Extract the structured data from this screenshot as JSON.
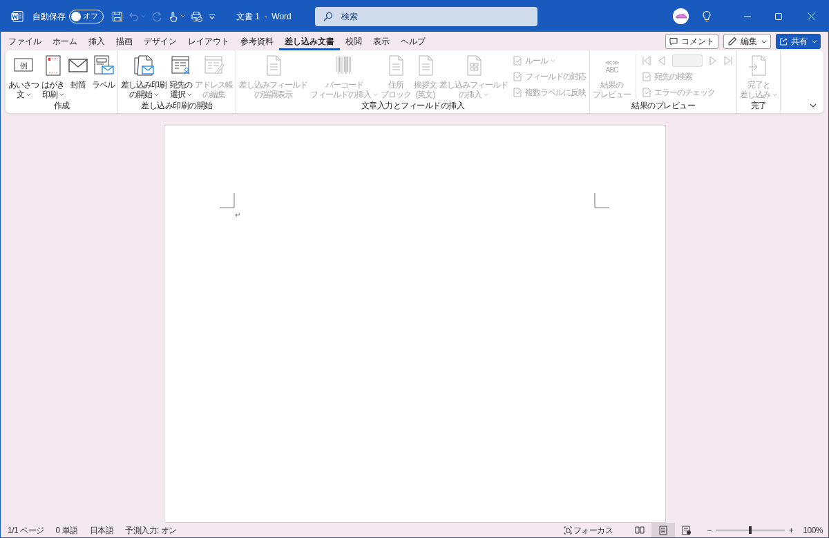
{
  "title_bar": {
    "autosave_label": "自動保存",
    "autosave": {
      "label": "オフ",
      "on": false
    },
    "quick_access": [
      {
        "kind": "save",
        "disabled": false
      },
      {
        "kind": "undo",
        "disabled": true
      },
      {
        "kind": "redo",
        "disabled": true
      },
      {
        "kind": "touch",
        "disabled": false
      },
      {
        "kind": "print_preview",
        "disabled": false
      },
      {
        "kind": "customize",
        "disabled": false
      }
    ],
    "document_title": "文書 1  -  Word",
    "search": {
      "placeholder": "検索"
    }
  },
  "menu_tabs": [
    {
      "label": "ファイル",
      "selected": false
    },
    {
      "label": "ホーム",
      "selected": false
    },
    {
      "label": "挿入",
      "selected": false
    },
    {
      "label": "描画",
      "selected": false
    },
    {
      "label": "デザイン",
      "selected": false
    },
    {
      "label": "レイアウト",
      "selected": false
    },
    {
      "label": "参考資料",
      "selected": false
    },
    {
      "label": "差し込み文書",
      "selected": true
    },
    {
      "label": "校閲",
      "selected": false
    },
    {
      "label": "表示",
      "selected": false
    },
    {
      "label": "ヘルプ",
      "selected": false
    }
  ],
  "header_buttons": [
    {
      "kind": "comment",
      "label": "コメント",
      "dropdown": false
    },
    {
      "kind": "edit",
      "label": "編集",
      "dropdown": true
    },
    {
      "kind": "share",
      "label": "共有",
      "dropdown": true
    }
  ],
  "ribbon": {
    "groups": [
      {
        "title": "作成",
        "items": [
          {
            "kind": "large",
            "lines": [
              "あいさつ",
              "文"
            ],
            "dropdown": true,
            "disabled": false,
            "icon_text": "例"
          },
          {
            "kind": "large",
            "lines": [
              "はがき",
              "印刷"
            ],
            "dropdown": true,
            "disabled": false
          },
          {
            "kind": "large",
            "lines": [
              "封筒"
            ],
            "dropdown": false,
            "disabled": false
          },
          {
            "kind": "large",
            "lines": [
              "ラベル"
            ],
            "dropdown": false,
            "disabled": false
          }
        ]
      },
      {
        "title": "差し込み印刷の開始",
        "items": [
          {
            "kind": "large",
            "lines": [
              "差し込み印刷",
              "の開始"
            ],
            "dropdown": true,
            "disabled": false
          },
          {
            "kind": "large",
            "lines": [
              "宛先の",
              "選択"
            ],
            "dropdown": true,
            "disabled": false
          },
          {
            "kind": "large",
            "lines": [
              "アドレス帳",
              "の編集"
            ],
            "dropdown": false,
            "disabled": true
          }
        ]
      },
      {
        "title": "文章入力とフィールドの挿入",
        "items": [
          {
            "kind": "large",
            "lines": [
              "差し込みフィールド",
              "の強調表示"
            ],
            "dropdown": false,
            "disabled": true
          },
          {
            "kind": "large",
            "lines": [
              "バーコード",
              "フィールドの挿入"
            ],
            "dropdown": true,
            "disabled": true
          },
          {
            "kind": "large",
            "lines": [
              "住所",
              "ブロック"
            ],
            "dropdown": false,
            "disabled": true
          },
          {
            "kind": "large",
            "lines": [
              "挨拶文",
              "(英文)"
            ],
            "dropdown": false,
            "disabled": true
          },
          {
            "kind": "large",
            "lines": [
              "差し込みフィールド",
              "の挿入"
            ],
            "dropdown": true,
            "disabled": true
          },
          {
            "kind": "column",
            "items": [
              {
                "kind": "small",
                "label": "ルール",
                "dropdown": true,
                "disabled": true
              },
              {
                "kind": "small",
                "label": "フィールドの対応",
                "dropdown": false,
                "disabled": true
              },
              {
                "kind": "small",
                "label": "複数ラベルに反映",
                "dropdown": false,
                "disabled": true
              }
            ]
          }
        ]
      },
      {
        "title": "結果のプレビュー",
        "items": [
          {
            "kind": "large",
            "lines": [
              "結果の",
              "プレビュー"
            ],
            "dropdown": false,
            "disabled": true,
            "icon_text": "≪ ≫",
            "icon_text_2": "ABC"
          },
          {
            "kind": "column",
            "items": [
              {
                "kind": "nav",
                "disabled": true
              },
              {
                "kind": "small",
                "label": "宛先の検索",
                "dropdown": false,
                "disabled": true
              },
              {
                "kind": "small",
                "label": "エラーのチェック",
                "dropdown": false,
                "disabled": true
              }
            ]
          }
        ]
      },
      {
        "title": "完了",
        "items": [
          {
            "kind": "large",
            "lines": [
              "完了と",
              "差し込み"
            ],
            "dropdown": true,
            "disabled": true
          }
        ]
      }
    ]
  },
  "document": {
    "paragraph_mark": "↵"
  },
  "status_bar": {
    "left": [
      "1/1 ページ",
      "0 単語",
      "日本語",
      "予測入力: オン"
    ],
    "focus_label": "フォーカス",
    "views": [
      {
        "selected": false
      },
      {
        "selected": true
      },
      {
        "selected": false
      }
    ],
    "zoom_out": "−",
    "zoom_in": "+",
    "zoom": {
      "level": 0.5
    },
    "zoom_label": "100%"
  }
}
